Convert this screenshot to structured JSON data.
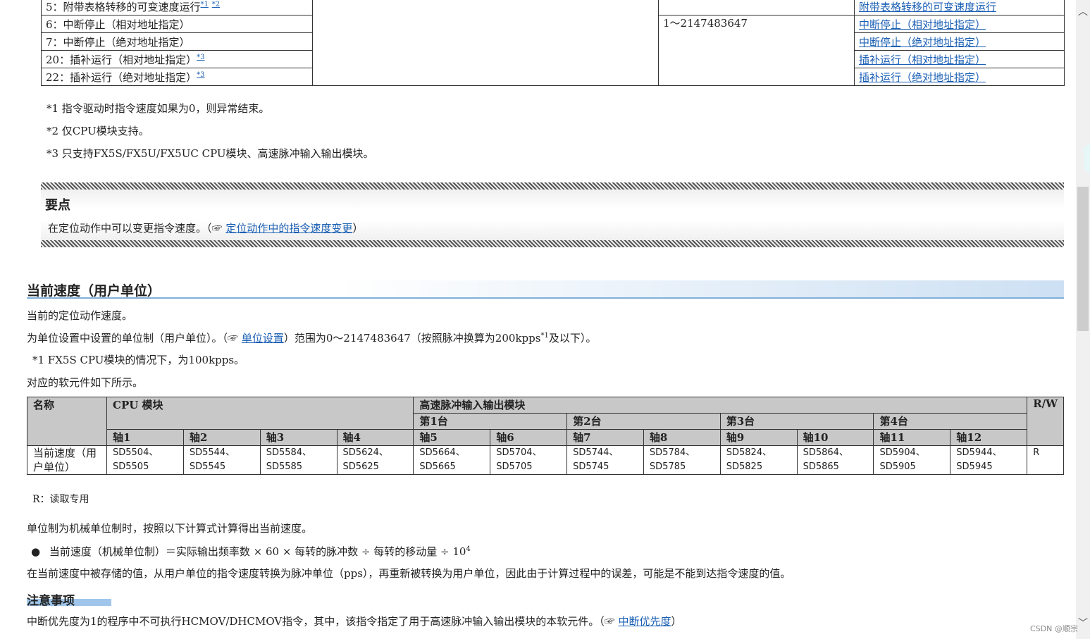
{
  "top_table": {
    "rows": [
      {
        "label": "5：附带表格转移的可变速度运行",
        "refs": [
          "*1",
          "*2"
        ],
        "range": "",
        "link": "附带表格转移的可变速度运行"
      },
      {
        "label": "6：中断停止（相对地址指定）",
        "refs": [],
        "range": "1～2147483647",
        "link": "中断停止（相对地址指定）"
      },
      {
        "label": "7：中断停止（绝对地址指定）",
        "refs": [],
        "range": "",
        "link": "中断停止（绝对地址指定）"
      },
      {
        "label": "20：插补运行（相对地址指定）",
        "refs": [
          "*3"
        ],
        "range": "",
        "link": "插补运行（相对地址指定）"
      },
      {
        "label": "22：插补运行（绝对地址指定）",
        "refs": [
          "*3"
        ],
        "range": "",
        "link": "插补运行（绝对地址指定）"
      }
    ]
  },
  "notes": [
    "*1 指令驱动时指令速度如果为0，则异常结束。",
    "*2 仅CPU模块支持。",
    "*3 只支持FX5S/FX5U/FX5UC CPU模块、高速脉冲输入输出模块。"
  ],
  "point": {
    "title": "要点",
    "text": "在定位动作中可以变更指令速度。（",
    "ref_icon": "☞",
    "link": "定位动作中的指令速度变更",
    "close": "）"
  },
  "section": {
    "title": "当前速度（用户单位）",
    "p1": "当前的定位动作速度。",
    "p2_a": "为单位设置中设置的单位制（用户单位）。（",
    "p2_icon": "☞",
    "p2_link": "单位设置",
    "p2_b": "）范围为0～2147483647（按照脉冲换算为200kpps",
    "p2_sup": "*1",
    "p2_c": "及以下）。",
    "p3": "*1 FX5S CPU模块的情况下，为100kpps。",
    "p4": "对应的软元件如下所示。"
  },
  "device_table": {
    "h_name": "名称",
    "h_cpu": "CPU 模块",
    "h_hs": "高速脉冲输入输出模块",
    "h_rw": "R/W",
    "units": [
      "第1台",
      "第2台",
      "第3台",
      "第4台"
    ],
    "axes": [
      "轴1",
      "轴2",
      "轴3",
      "轴4",
      "轴5",
      "轴6",
      "轴7",
      "轴8",
      "轴9",
      "轴10",
      "轴11",
      "轴12"
    ],
    "row_name": "当前速度（用户单位）",
    "devices": [
      [
        "SD5504、",
        "SD5505"
      ],
      [
        "SD5544、",
        "SD5545"
      ],
      [
        "SD5584、",
        "SD5585"
      ],
      [
        "SD5624、",
        "SD5625"
      ],
      [
        "SD5664、",
        "SD5665"
      ],
      [
        "SD5704、",
        "SD5705"
      ],
      [
        "SD5744、",
        "SD5745"
      ],
      [
        "SD5784、",
        "SD5785"
      ],
      [
        "SD5824、",
        "SD5825"
      ],
      [
        "SD5864、",
        "SD5865"
      ],
      [
        "SD5904、",
        "SD5905"
      ],
      [
        "SD5944、",
        "SD5945"
      ]
    ],
    "rw": "R"
  },
  "rw_note": "R：读取专用",
  "calc": {
    "intro": "单位制为机械单位制时，按照以下计算式计算得出当前速度。",
    "formula": "当前速度（机械单位制）＝实际输出频率数 × 60 × 每转的脉冲数 ÷ 每转的移动量 ÷ 10",
    "formula_sup": "4",
    "explain": "在当前速度中被存储的值，从用户单位的指令速度转换为脉冲单位（pps），再重新被转换为用户单位，因此由于计算过程中的误差，可能是不能到达指令速度的值。"
  },
  "caution": {
    "title": "注意事项",
    "text_a": "中断优先度为1的程序中不可执行HCMOV/DHCMOV指令，其中，该指令指定了用于高速脉冲输入输出模块的本软元件。（",
    "icon": "☞",
    "link": "中断优先度",
    "text_b": "）"
  },
  "watermark": "CSDN @顺宗"
}
